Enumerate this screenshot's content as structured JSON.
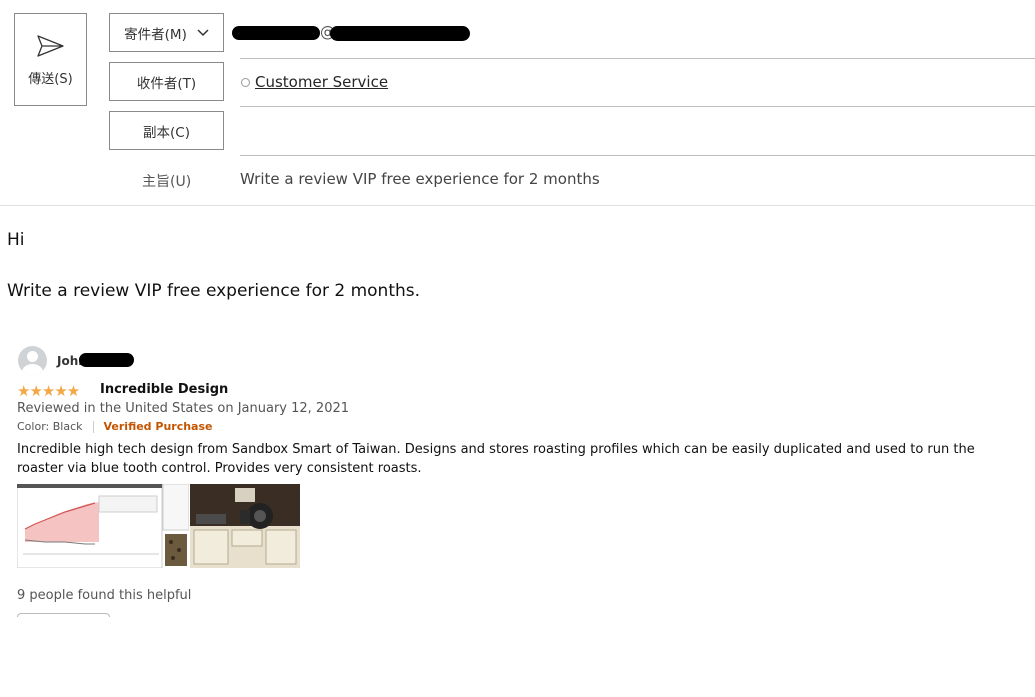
{
  "compose": {
    "send_label": "傳送(S)",
    "from_label": "寄件者(M)",
    "from_address_at": "@",
    "to_label": "收件者(T)",
    "to_recipient": "Customer Service",
    "cc_label": "副本(C)",
    "subject_label": "主旨(U)",
    "subject_value": "Write a review VIP free experience for 2 months"
  },
  "body": {
    "greeting": "Hi",
    "line": "Write a review VIP free experience for 2 months."
  },
  "review": {
    "reviewer_name": "John",
    "stars": "★★★★★",
    "rating": 5,
    "title": "Incredible Design",
    "date": "Reviewed in the United States on January 12, 2021",
    "color": "Color: Black",
    "verified": "Verified Purchase",
    "text": "Incredible high tech design from Sandbox Smart of Taiwan. Designs and stores roasting profiles which can be easily duplicated and used to run the roaster via blue tooth control. Provides very consistent roasts.",
    "helpful": "9 people found this helpful"
  },
  "colors": {
    "star": "#f3a847",
    "verified": "#c45500",
    "border": "#8a8a8a"
  }
}
